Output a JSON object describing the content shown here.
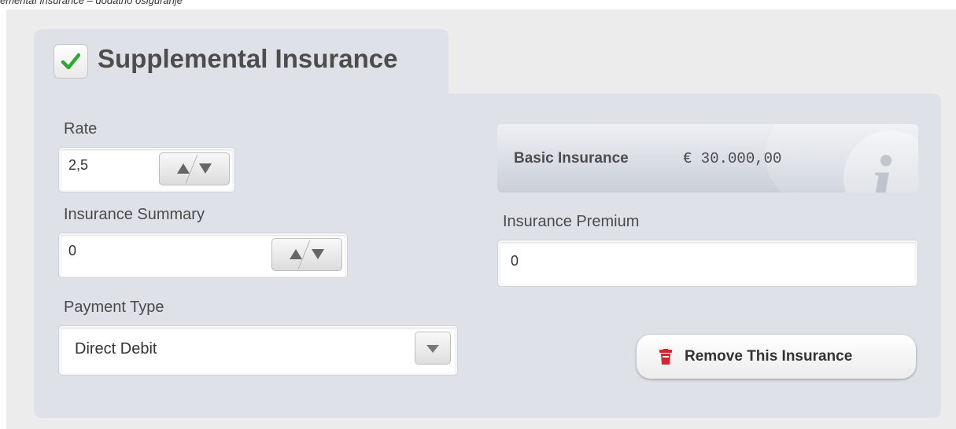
{
  "caption": "ementaI insurance – dodatno osiguranje",
  "section": {
    "title": "Supplemental Insurance",
    "enabled": true
  },
  "rate": {
    "label": "Rate",
    "value": "2,5"
  },
  "insurance_summary": {
    "label": "Insurance Summary",
    "value": "0"
  },
  "payment_type": {
    "label": "Payment Type",
    "value": "Direct Debit"
  },
  "basic_insurance": {
    "label": "Basic Insurance",
    "amount": "€ 30.000,00",
    "icon": "info-icon"
  },
  "insurance_premium": {
    "label": "Insurance Premium",
    "value": "0"
  },
  "remove_button": {
    "label": "Remove This Insurance",
    "icon": "trash-icon",
    "icon_color": "#d9232e"
  },
  "colors": {
    "panel": "#dee1e7",
    "checkmark": "#2fa832",
    "background": "#ececec"
  }
}
